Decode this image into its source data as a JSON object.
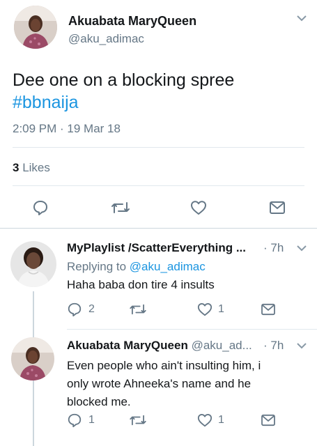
{
  "main_tweet": {
    "author_name": "Akuabata MaryQueen",
    "author_handle": "@aku_adimac",
    "text": "Dee one on a blocking spree",
    "hashtag": "#bbnaija",
    "timestamp": "2:09 PM · 19 Mar 18",
    "likes_count": "3",
    "likes_label": "Likes"
  },
  "replies": [
    {
      "author_name": "MyPlaylist /ScatterEverything ...",
      "dot_time": "· 7h",
      "replying_prefix": "Replying to",
      "replying_handle": "@aku_adimac",
      "text": "Haha baba don tire 4 insults",
      "reply_count": "2",
      "retweet_count": "",
      "like_count": "1"
    },
    {
      "author_name": "Akuabata MaryQueen",
      "author_handle": "@aku_ad...",
      "dot_time": "· 7h",
      "text_lines": [
        "Even people who ain't insulting him, i",
        "only wrote Ahneeka's name and he",
        "blocked me."
      ],
      "reply_count": "1",
      "retweet_count": "",
      "like_count": "1"
    }
  ],
  "colors": {
    "link": "#1b95e0",
    "muted": "#657786",
    "divider": "#e1e8ed",
    "text": "#14171a"
  }
}
